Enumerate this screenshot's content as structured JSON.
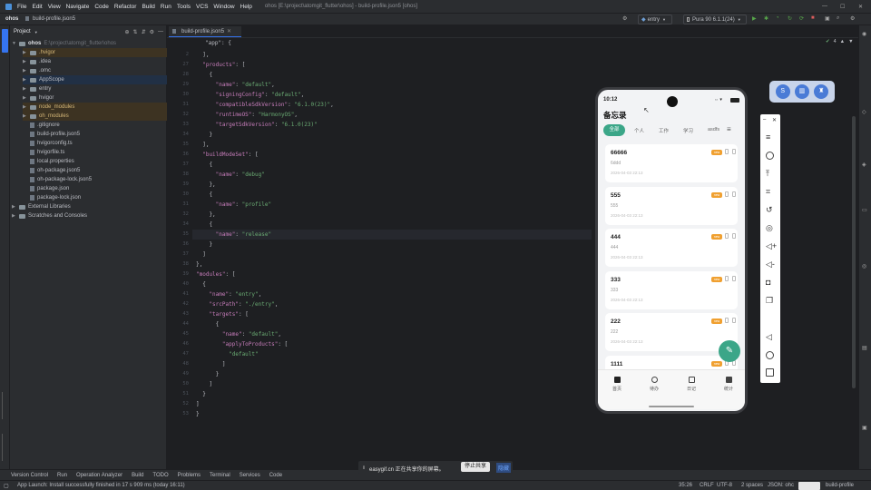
{
  "window": {
    "menu": [
      "File",
      "Edit",
      "View",
      "Navigate",
      "Code",
      "Refactor",
      "Build",
      "Run",
      "Tools",
      "VCS",
      "Window",
      "Help"
    ],
    "title": "ohos [E:\\project\\atomgit_flutter\\ohos] - build-profile.json5 [ohos]"
  },
  "navbar": {
    "breadcrumb": [
      "ohos",
      "build-profile.json5"
    ],
    "device_config": "entry",
    "device": "Pura 90 6.1.1(24)"
  },
  "project_panel": {
    "title": "Project",
    "root_label": "ohos",
    "root_path": "E:\\project\\atomgit_flutter\\ohos",
    "items": [
      {
        "label": ".hvigor",
        "type": "folder",
        "depth": 1,
        "highlight": true
      },
      {
        "label": ".idea",
        "type": "folder",
        "depth": 1,
        "highlight": false
      },
      {
        "label": ".omc",
        "type": "folder",
        "depth": 1,
        "highlight": false
      },
      {
        "label": "AppScope",
        "type": "folder",
        "depth": 1,
        "highlight": false
      },
      {
        "label": "entry",
        "type": "folder",
        "depth": 1,
        "highlight": false
      },
      {
        "label": "hvigor",
        "type": "folder",
        "depth": 1,
        "highlight": false
      },
      {
        "label": "node_modules",
        "type": "folder",
        "depth": 1,
        "highlight": true
      },
      {
        "label": "oh_modules",
        "type": "folder",
        "depth": 1,
        "highlight": true
      },
      {
        "label": ".gitignore",
        "type": "file",
        "depth": 1,
        "highlight": false
      },
      {
        "label": "build-profile.json5",
        "type": "file",
        "depth": 1,
        "highlight": false
      },
      {
        "label": "hvigorconfig.ts",
        "type": "file",
        "depth": 1,
        "highlight": false
      },
      {
        "label": "hvigorfile.ts",
        "type": "file",
        "depth": 1,
        "highlight": false
      },
      {
        "label": "local.properties",
        "type": "file",
        "depth": 1,
        "highlight": false
      },
      {
        "label": "oh-package.json5",
        "type": "file",
        "depth": 1,
        "highlight": false
      },
      {
        "label": "oh-package-lock.json5",
        "type": "file",
        "depth": 1,
        "highlight": false
      },
      {
        "label": "package.json",
        "type": "file",
        "depth": 1,
        "highlight": false
      },
      {
        "label": "package-lock.json",
        "type": "file",
        "depth": 1,
        "highlight": false
      },
      {
        "label": "External Libraries",
        "type": "folder",
        "depth": 0,
        "highlight": false
      },
      {
        "label": "Scratches and Consoles",
        "type": "folder",
        "depth": 0,
        "highlight": false
      }
    ]
  },
  "editor": {
    "tab": "build-profile.json5",
    "breadcrumb": "\"app\": {",
    "warning_count": "4",
    "lines": [
      {
        "n": "2",
        "text": "  ],"
      },
      {
        "n": "27",
        "text": "  \"products\": ["
      },
      {
        "n": "28",
        "text": "    {"
      },
      {
        "n": "29",
        "text": "      \"name\": \"default\","
      },
      {
        "n": "30",
        "text": "      \"signingConfig\": \"default\","
      },
      {
        "n": "31",
        "text": "      \"compatibleSdkVersion\": \"6.1.0(23)\","
      },
      {
        "n": "32",
        "text": "      \"runtimeOS\": \"HarmonyOS\","
      },
      {
        "n": "33",
        "text": "      \"targetSdkVersion\": \"6.1.0(23)\""
      },
      {
        "n": "34",
        "text": "    }"
      },
      {
        "n": "35",
        "text": "  ],"
      },
      {
        "n": "36",
        "text": "  \"buildModeSet\": ["
      },
      {
        "n": "37",
        "text": "    {"
      },
      {
        "n": "38",
        "text": "      \"name\": \"debug\""
      },
      {
        "n": "39",
        "text": "    },"
      },
      {
        "n": "30",
        "text": "    {"
      },
      {
        "n": "31",
        "text": "      \"name\": \"profile\""
      },
      {
        "n": "32",
        "text": "    },"
      },
      {
        "n": "34",
        "text": "    {"
      },
      {
        "n": "35",
        "text": "      \"name\": \"release\""
      },
      {
        "n": "36",
        "text": "    }"
      },
      {
        "n": "37",
        "text": "  ]"
      },
      {
        "n": "38",
        "text": "},"
      },
      {
        "n": "39",
        "text": "\"modules\": ["
      },
      {
        "n": "40",
        "text": "  {"
      },
      {
        "n": "41",
        "text": "    \"name\": \"entry\","
      },
      {
        "n": "42",
        "text": "    \"srcPath\": \"./entry\","
      },
      {
        "n": "43",
        "text": "    \"targets\": ["
      },
      {
        "n": "44",
        "text": "      {"
      },
      {
        "n": "45",
        "text": "        \"name\": \"default\","
      },
      {
        "n": "46",
        "text": "        \"applyToProducts\": ["
      },
      {
        "n": "47",
        "text": "          \"default\""
      },
      {
        "n": "48",
        "text": "        ]"
      },
      {
        "n": "49",
        "text": "      }"
      },
      {
        "n": "50",
        "text": "    ]"
      },
      {
        "n": "51",
        "text": "  }"
      },
      {
        "n": "52",
        "text": "]"
      },
      {
        "n": "53",
        "text": "}"
      }
    ]
  },
  "phone": {
    "time": "10:12",
    "app_title": "备忘录",
    "tabs": [
      "全部",
      "个人",
      "工作",
      "学习",
      "asdfs"
    ],
    "notes": [
      {
        "title": "66666",
        "content": "6ddd",
        "date": "2026-04-03 22:13",
        "tag": "new"
      },
      {
        "title": "555",
        "content": "555",
        "date": "2026-04-03 22:13",
        "tag": "new"
      },
      {
        "title": "444",
        "content": "444",
        "date": "2026-04-03 22:13",
        "tag": "new"
      },
      {
        "title": "333",
        "content": "333",
        "date": "2026-04-03 22:13",
        "tag": "new"
      },
      {
        "title": "222",
        "content": "222",
        "date": "2026-04-03 22:13",
        "tag": "new"
      },
      {
        "title": "1111",
        "content": "",
        "date": "",
        "tag": "new"
      }
    ],
    "nav": [
      "首页",
      "待办",
      "日记",
      "统计"
    ]
  },
  "bottom_tools": [
    "Version Control",
    "Run",
    "Operation Analyzer",
    "Build",
    "TODO",
    "Problems",
    "Terminal",
    "Services",
    "Code"
  ],
  "share_bar": {
    "text": "easygif.cn 正在共享你的屏幕。",
    "stop": "停止共享",
    "hide": "隐藏"
  },
  "statusbar": {
    "message": "App Launch: Install successfully finished in 17 s 909 ms (today 16:11)",
    "position": "35:26",
    "line_sep": "CRLF",
    "encoding": "UTF-8",
    "indent": "2 spaces",
    "schema": "JSON: ohc",
    "file": "build-profile"
  },
  "colors": {
    "accent": "#3ba688",
    "tag": "#f0a030",
    "fab": "#3ba688"
  }
}
